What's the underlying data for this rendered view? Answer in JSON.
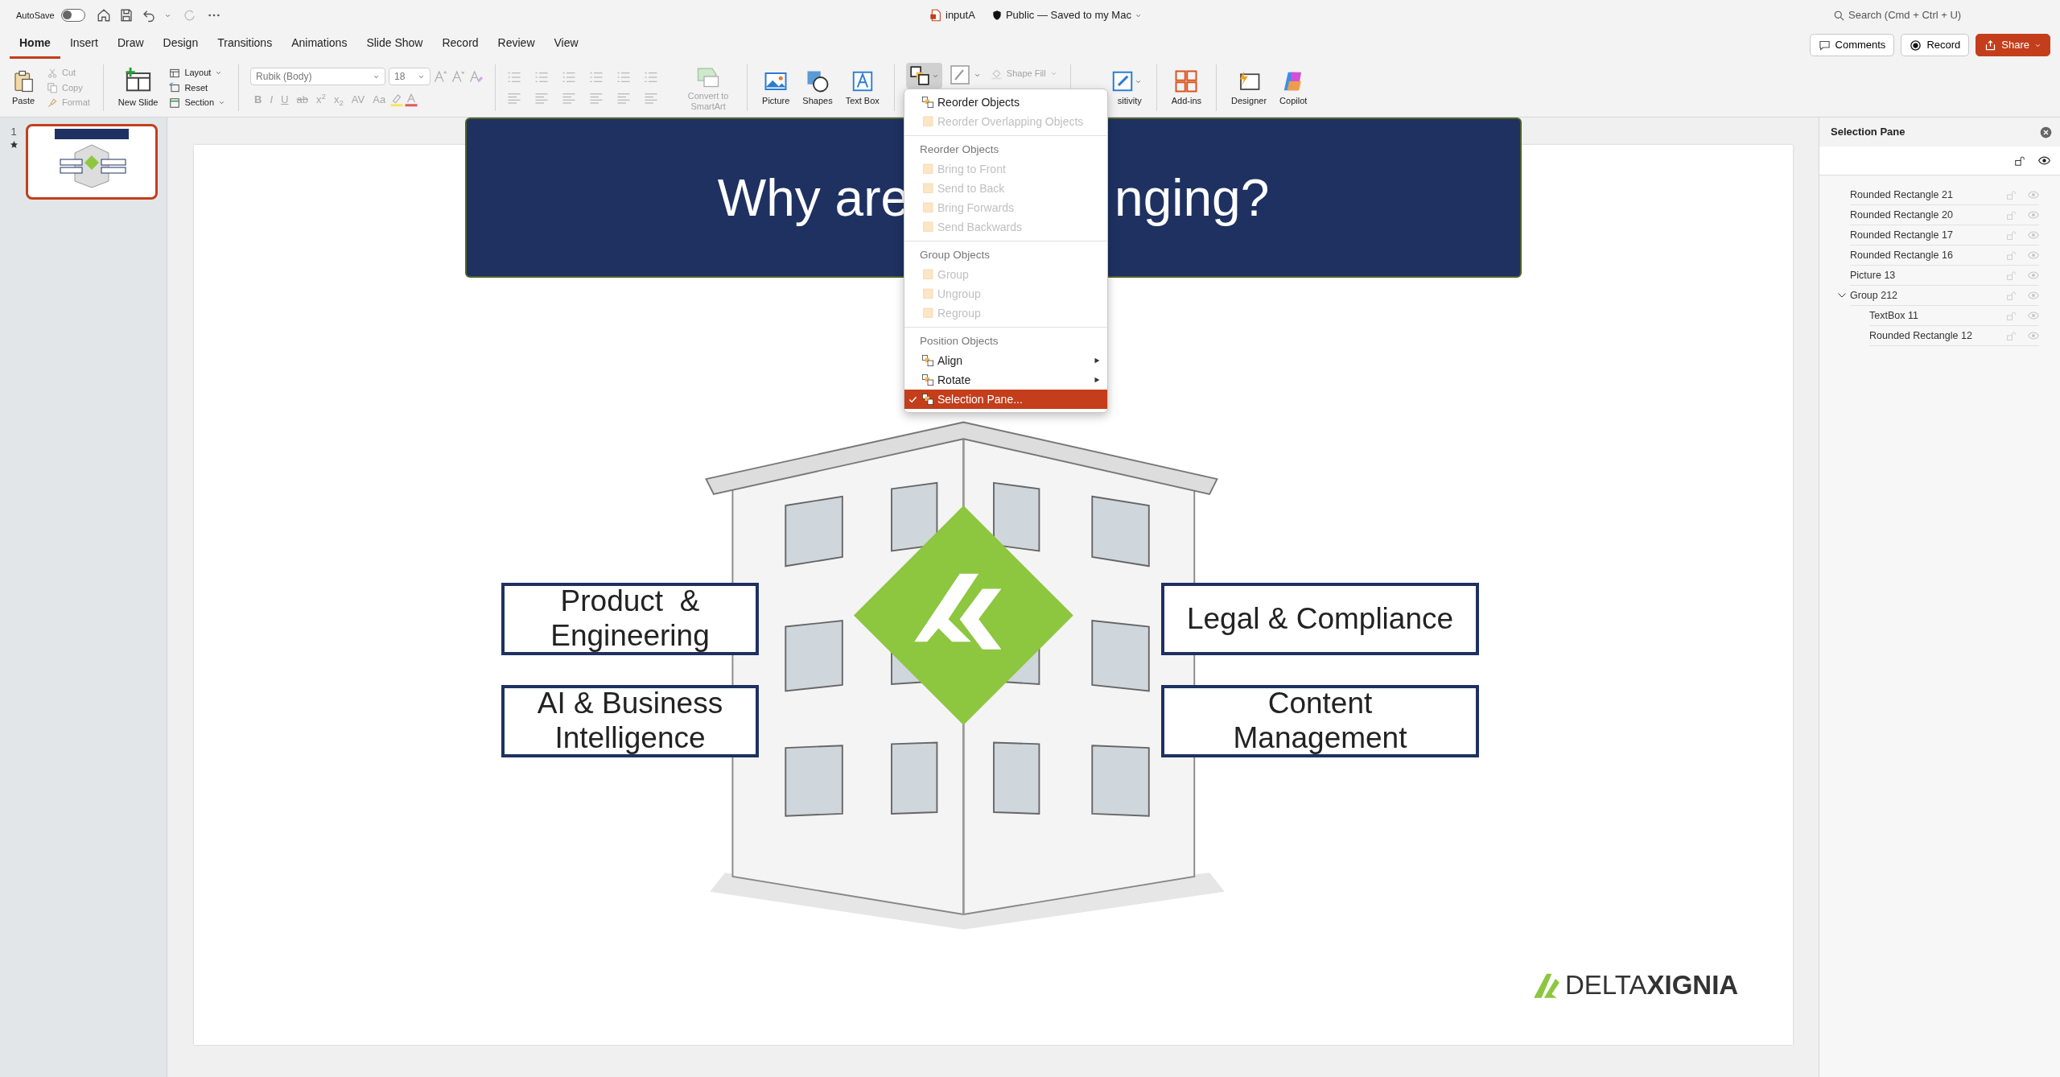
{
  "titlebar": {
    "autosave_label": "AutoSave",
    "autosave_on": false,
    "filename": "inputA",
    "status": "Public — Saved to my Mac",
    "search_placeholder": "Search (Cmd + Ctrl + U)"
  },
  "tabs": [
    {
      "label": "Home",
      "selected": true
    },
    {
      "label": "Insert",
      "selected": false
    },
    {
      "label": "Draw",
      "selected": false
    },
    {
      "label": "Design",
      "selected": false
    },
    {
      "label": "Transitions",
      "selected": false
    },
    {
      "label": "Animations",
      "selected": false
    },
    {
      "label": "Slide Show",
      "selected": false
    },
    {
      "label": "Record",
      "selected": false
    },
    {
      "label": "Review",
      "selected": false
    },
    {
      "label": "View",
      "selected": false
    }
  ],
  "actions": {
    "comments": "Comments",
    "record": "Record",
    "share": "Share"
  },
  "ribbon": {
    "paste": "Paste",
    "clipboard": [
      "Cut",
      "Copy",
      "Format"
    ],
    "new_slide": "New Slide",
    "slide_items": [
      "Layout",
      "Reset",
      "Section"
    ],
    "font": "Rubik (Body)",
    "size": "18",
    "format_glyphs": [
      "B",
      "I",
      "U",
      "ab",
      "x$^{2}$",
      "x$_{2}$",
      "AV",
      "Aa"
    ],
    "smartart": "Convert to SmartArt",
    "insert": [
      "Picture",
      "Shapes",
      "Text Box"
    ],
    "shape_fill": "Shape Fill",
    "sensitivity": "sitivity",
    "addins": "Add-ins",
    "designer": "Designer",
    "copilot": "Copilot"
  },
  "thumbnails": [
    {
      "number": "1",
      "selected": true
    }
  ],
  "slide": {
    "title_parts": [
      "Why are",
      "nging?"
    ],
    "left_labels": [
      "Product  &\nEngineering",
      "AI & Business Intelligence"
    ],
    "right_labels": [
      "Legal & Compliance",
      "Content\nManagement"
    ],
    "logo": "DELTA**XIGNIA**"
  },
  "menu": {
    "items": [
      {
        "kind": "item",
        "label": "Reorder Objects",
        "disabled": false,
        "selected": false,
        "checked": false
      },
      {
        "kind": "item",
        "label": "Reorder Overlapping Objects",
        "disabled": true,
        "selected": false,
        "checked": false
      },
      {
        "kind": "separator"
      },
      {
        "kind": "header",
        "label": "Reorder Objects"
      },
      {
        "kind": "item",
        "label": "Bring to Front",
        "disabled": true,
        "selected": false,
        "checked": false
      },
      {
        "kind": "item",
        "label": "Send to Back",
        "disabled": true,
        "selected": false,
        "checked": false
      },
      {
        "kind": "item",
        "label": "Bring Forwards",
        "disabled": true,
        "selected": false,
        "checked": false
      },
      {
        "kind": "item",
        "label": "Send Backwards",
        "disabled": true,
        "selected": false,
        "checked": false
      },
      {
        "kind": "separator"
      },
      {
        "kind": "header",
        "label": "Group Objects"
      },
      {
        "kind": "item",
        "label": "Group",
        "disabled": true,
        "selected": false,
        "checked": false
      },
      {
        "kind": "item",
        "label": "Ungroup",
        "disabled": true,
        "selected": false,
        "checked": false
      },
      {
        "kind": "item",
        "label": "Regroup",
        "disabled": true,
        "selected": false,
        "checked": false
      },
      {
        "kind": "separator"
      },
      {
        "kind": "header",
        "label": "Position Objects"
      },
      {
        "kind": "item",
        "label": "Align",
        "disabled": false,
        "selected": false,
        "checked": false,
        "submenu": true
      },
      {
        "kind": "item",
        "label": "Rotate",
        "disabled": false,
        "selected": false,
        "checked": false,
        "submenu": true
      },
      {
        "kind": "item",
        "label": "Selection Pane...",
        "disabled": false,
        "selected": true,
        "checked": true
      }
    ]
  },
  "selection_pane": {
    "title": "Selection Pane",
    "items": [
      {
        "label": "Rounded Rectangle 21"
      },
      {
        "label": "Rounded Rectangle 20"
      },
      {
        "label": "Rounded Rectangle 17"
      },
      {
        "label": "Rounded Rectangle 16"
      },
      {
        "label": "Picture 13"
      },
      {
        "label": "Group 212",
        "expanded": true,
        "children": [
          {
            "label": "TextBox 11"
          },
          {
            "label": "Rounded Rectangle 12"
          }
        ]
      }
    ]
  }
}
